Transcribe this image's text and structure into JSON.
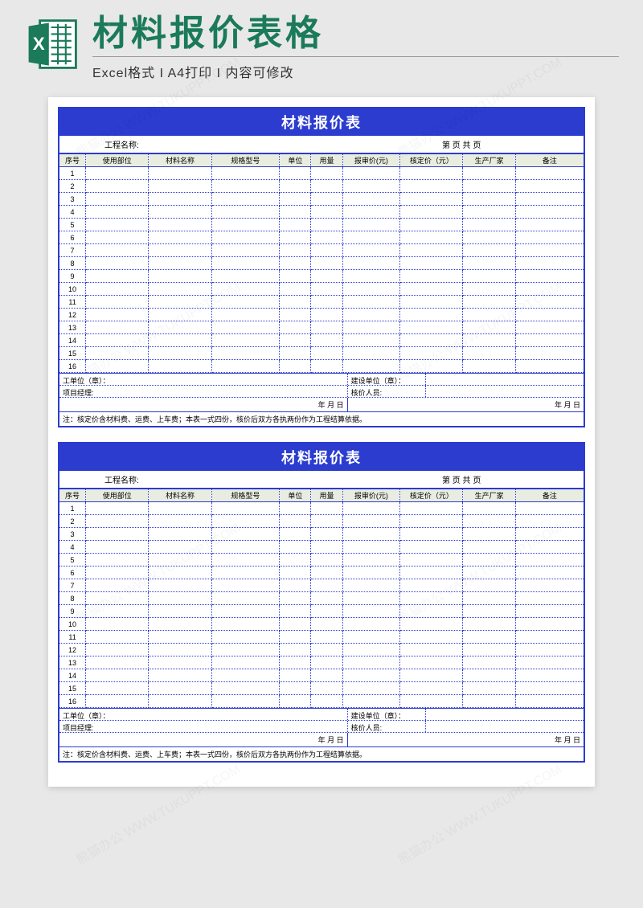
{
  "header": {
    "main_title": "材料报价表格",
    "subtitle": "Excel格式 I A4打印 I 内容可修改"
  },
  "form": {
    "title": "材料报价表",
    "project_label": "工程名称:",
    "page_label": "第  页  共  页",
    "columns": {
      "seq": "序号",
      "part": "使用部位",
      "name": "材料名称",
      "spec": "规格型号",
      "unit": "单位",
      "qty": "用量",
      "price1": "报审价(元)",
      "price2": "核定价（元）",
      "mfg": "生产厂家",
      "note": "备注"
    },
    "rows": [
      1,
      2,
      3,
      4,
      5,
      6,
      7,
      8,
      9,
      10,
      11,
      12,
      13,
      14,
      15,
      16
    ],
    "footer": {
      "unit_seal": "工单位（章）：",
      "build_unit": "建设单位（章）：",
      "pm": "项目经理:",
      "pricer": "核价人员:",
      "date": "年 月 日"
    },
    "note": "注：核定价含材料费、运费、上车费；本表一式四份，核价后双方各执两份作为工程结算依据。"
  },
  "watermark": "熊猫办公 WWW.TUKUPPT.COM"
}
